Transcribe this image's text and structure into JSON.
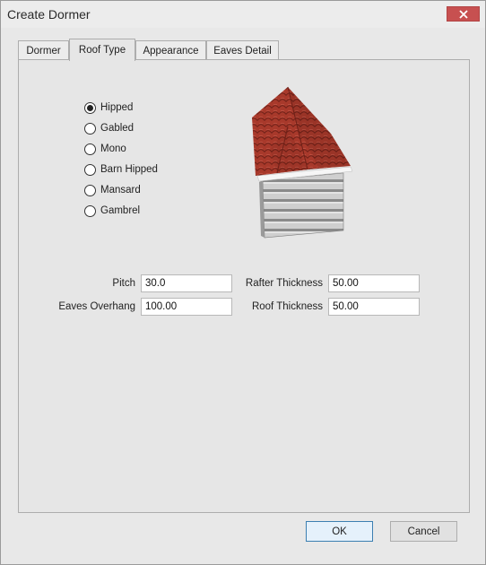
{
  "window": {
    "title": "Create Dormer"
  },
  "tabs": [
    {
      "label": "Dormer"
    },
    {
      "label": "Roof Type"
    },
    {
      "label": "Appearance"
    },
    {
      "label": "Eaves Detail"
    }
  ],
  "active_tab": "Roof Type",
  "roof_types": [
    {
      "label": "Hipped",
      "selected": true
    },
    {
      "label": "Gabled",
      "selected": false
    },
    {
      "label": "Mono",
      "selected": false
    },
    {
      "label": "Barn Hipped",
      "selected": false
    },
    {
      "label": "Mansard",
      "selected": false
    },
    {
      "label": "Gambrel",
      "selected": false
    }
  ],
  "fields": {
    "pitch": {
      "label": "Pitch",
      "value": "30.0"
    },
    "eaves_overhang": {
      "label": "Eaves Overhang",
      "value": "100.00"
    },
    "rafter_thickness": {
      "label": "Rafter Thickness",
      "value": "50.00"
    },
    "roof_thickness": {
      "label": "Roof Thickness",
      "value": "50.00"
    }
  },
  "buttons": {
    "ok": "OK",
    "cancel": "Cancel"
  },
  "colors": {
    "close": "#c75050",
    "roof_tile": "#a8392b",
    "wall_siding": "#c8c8c8",
    "default_button_border": "#3c7fb1"
  },
  "icons": {
    "close": "close-icon",
    "radio_selected": "radio-selected",
    "radio_empty": "radio-empty"
  }
}
